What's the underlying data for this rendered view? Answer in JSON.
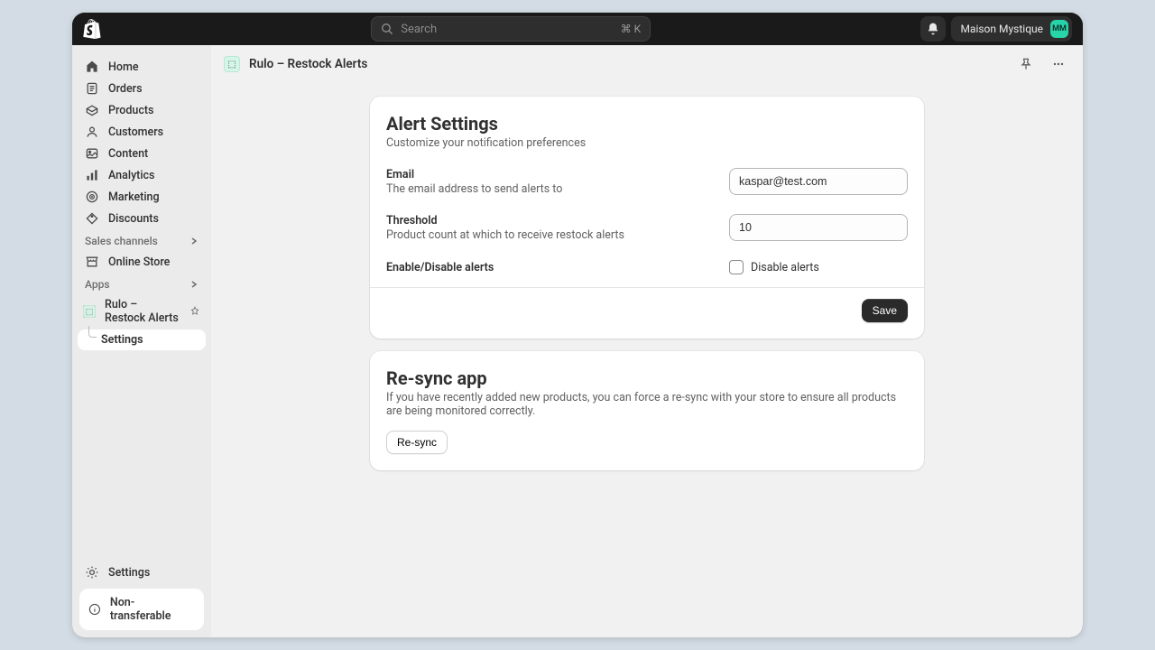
{
  "topbar": {
    "search_placeholder": "Search",
    "kbd": "⌘ K",
    "store_name": "Maison Mystique",
    "avatar_initials": "MM"
  },
  "sidebar": {
    "nav": [
      {
        "label": "Home"
      },
      {
        "label": "Orders"
      },
      {
        "label": "Products"
      },
      {
        "label": "Customers"
      },
      {
        "label": "Content"
      },
      {
        "label": "Analytics"
      },
      {
        "label": "Marketing"
      },
      {
        "label": "Discounts"
      }
    ],
    "sections": {
      "sales_channels": "Sales channels",
      "apps": "Apps"
    },
    "online_store": "Online Store",
    "app_name": "Rulo – Restock Alerts",
    "app_sub": "Settings",
    "bottom_settings": "Settings",
    "non_transferable": "Non-transferable"
  },
  "page": {
    "title": "Rulo – Restock Alerts"
  },
  "alert_card": {
    "heading": "Alert Settings",
    "subtitle": "Customize your notification preferences",
    "email_label": "Email",
    "email_help": "The email address to send alerts to",
    "email_value": "kaspar@test.com",
    "threshold_label": "Threshold",
    "threshold_help": "Product count at which to receive restock alerts",
    "threshold_value": "10",
    "toggle_label": "Enable/Disable alerts",
    "checkbox_label": "Disable alerts",
    "save_btn": "Save"
  },
  "resync_card": {
    "heading": "Re-sync app",
    "desc": "If you have recently added new products, you can force a re-sync with your store to ensure all products are being monitored correctly.",
    "btn": "Re-sync"
  }
}
